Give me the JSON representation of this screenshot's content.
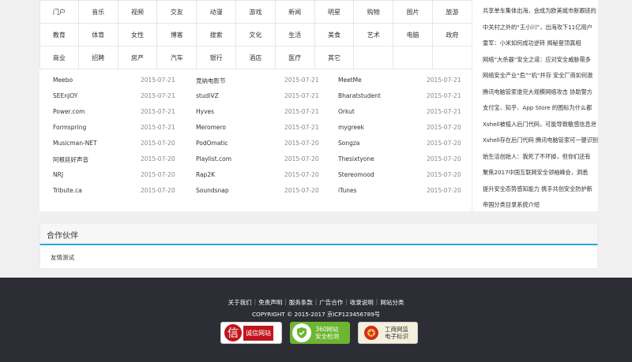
{
  "categories": [
    [
      "门户",
      "音乐",
      "视频",
      "交友",
      "动漫",
      "游戏",
      "新闻",
      "明星",
      "购物",
      "图片",
      "旅游"
    ],
    [
      "教育",
      "体育",
      "女性",
      "博客",
      "搜索",
      "文化",
      "生活",
      "美食",
      "艺术",
      "电脑",
      "政府"
    ],
    [
      "商业",
      "招聘",
      "房产",
      "汽车",
      "银行",
      "酒店",
      "医疗",
      "其它",
      "",
      "",
      ""
    ]
  ],
  "sites": [
    [
      {
        "name": "Meebo",
        "date": "2015-07-21"
      },
      {
        "name": "竞纳电影节",
        "date": "2015-07-21"
      },
      {
        "name": "MeetMe",
        "date": "2015-07-21"
      }
    ],
    [
      {
        "name": "SEEnJOY",
        "date": "2015-07-21"
      },
      {
        "name": "studiVZ",
        "date": "2015-07-21"
      },
      {
        "name": "Bharatstudent",
        "date": "2015-07-21"
      }
    ],
    [
      {
        "name": "Power.com",
        "date": "2015-07-21"
      },
      {
        "name": "Hyves",
        "date": "2015-07-21"
      },
      {
        "name": "Orkut",
        "date": "2015-07-21"
      }
    ],
    [
      {
        "name": "Formspring",
        "date": "2015-07-21"
      },
      {
        "name": "Meromero",
        "date": "2015-07-21"
      },
      {
        "name": "mygreek",
        "date": "2015-07-20"
      }
    ],
    [
      {
        "name": "Musicman-NET",
        "date": "2015-07-20"
      },
      {
        "name": "PodOmatic",
        "date": "2015-07-20"
      },
      {
        "name": "Songza",
        "date": "2015-07-20"
      }
    ],
    [
      {
        "name": "阿根廷好声音",
        "date": "2015-07-20"
      },
      {
        "name": "Playlist.com",
        "date": "2015-07-20"
      },
      {
        "name": "Thesixtyone",
        "date": "2015-07-20"
      }
    ],
    [
      {
        "name": "NRJ",
        "date": "2015-07-20"
      },
      {
        "name": "Rap2K",
        "date": "2015-07-20"
      },
      {
        "name": "Stereomood",
        "date": "2015-07-20"
      }
    ],
    [
      {
        "name": "Tribute.ca",
        "date": "2015-07-20"
      },
      {
        "name": "Soundsnap",
        "date": "2015-07-20"
      },
      {
        "name": "iTunes",
        "date": "2015-07-20"
      }
    ]
  ],
  "news": [
    "共享单车集体出海，会成为欧美城市新跟班的",
    "中关村之外的“王小川”，出海攻下11亿用户",
    "雷军：小米如何成功逆转 揭秘登顶真相",
    "网络“大杀器”安全之道：应对安全威胁需多",
    "网络安全产业“危”“机”并存 安全厂商如何激",
    "腾讯电脑管家谁完大规模网络攻击 协助警方",
    "支付宝、知乎、App Store 的图标为什么都",
    "Xshell被植入后门代码，可能导致敏感信息泄",
    "Xshell存在后门代码 腾讯电脑管家可一键识别",
    "始生活创始人：我死了不坏掉，但你们还有",
    "聚焦2017中国互联网安全领袖峰会，洞悉",
    "提升安全态势感知能力 携手共创安全防护新",
    "帝国分类目录系统介绍"
  ],
  "partners": {
    "title": "合作伙伴",
    "link": "友情测试"
  },
  "footer": {
    "links": [
      "关于我们",
      "免责声明",
      "服务条款",
      "广告合作",
      "收录说明",
      "网站分类"
    ],
    "copyright": "COPYRIGHT © 2015-2017 京ICP123456789号",
    "badges": {
      "credit": "诚信网站",
      "safe_line1": "360网站",
      "safe_line2": "安全检测",
      "gov_line1": "工商网监",
      "gov_line2": "电子标识"
    }
  },
  "colors": {
    "accent": "#2aa7df",
    "footer_bg": "#2c2d35",
    "credit_red": "#c1151d",
    "safe_green": "#6cb631"
  }
}
